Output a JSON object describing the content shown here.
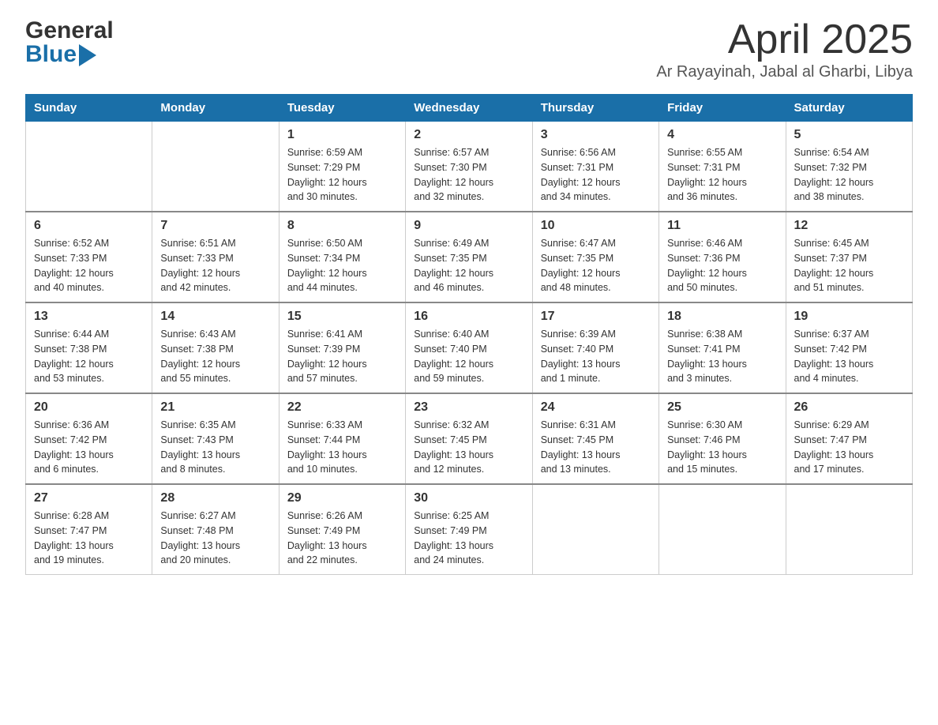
{
  "header": {
    "logo_general": "General",
    "logo_blue": "Blue",
    "title": "April 2025",
    "subtitle": "Ar Rayayinah, Jabal al Gharbi, Libya"
  },
  "calendar": {
    "days_of_week": [
      "Sunday",
      "Monday",
      "Tuesday",
      "Wednesday",
      "Thursday",
      "Friday",
      "Saturday"
    ],
    "weeks": [
      [
        {
          "day": "",
          "info": ""
        },
        {
          "day": "",
          "info": ""
        },
        {
          "day": "1",
          "info": "Sunrise: 6:59 AM\nSunset: 7:29 PM\nDaylight: 12 hours\nand 30 minutes."
        },
        {
          "day": "2",
          "info": "Sunrise: 6:57 AM\nSunset: 7:30 PM\nDaylight: 12 hours\nand 32 minutes."
        },
        {
          "day": "3",
          "info": "Sunrise: 6:56 AM\nSunset: 7:31 PM\nDaylight: 12 hours\nand 34 minutes."
        },
        {
          "day": "4",
          "info": "Sunrise: 6:55 AM\nSunset: 7:31 PM\nDaylight: 12 hours\nand 36 minutes."
        },
        {
          "day": "5",
          "info": "Sunrise: 6:54 AM\nSunset: 7:32 PM\nDaylight: 12 hours\nand 38 minutes."
        }
      ],
      [
        {
          "day": "6",
          "info": "Sunrise: 6:52 AM\nSunset: 7:33 PM\nDaylight: 12 hours\nand 40 minutes."
        },
        {
          "day": "7",
          "info": "Sunrise: 6:51 AM\nSunset: 7:33 PM\nDaylight: 12 hours\nand 42 minutes."
        },
        {
          "day": "8",
          "info": "Sunrise: 6:50 AM\nSunset: 7:34 PM\nDaylight: 12 hours\nand 44 minutes."
        },
        {
          "day": "9",
          "info": "Sunrise: 6:49 AM\nSunset: 7:35 PM\nDaylight: 12 hours\nand 46 minutes."
        },
        {
          "day": "10",
          "info": "Sunrise: 6:47 AM\nSunset: 7:35 PM\nDaylight: 12 hours\nand 48 minutes."
        },
        {
          "day": "11",
          "info": "Sunrise: 6:46 AM\nSunset: 7:36 PM\nDaylight: 12 hours\nand 50 minutes."
        },
        {
          "day": "12",
          "info": "Sunrise: 6:45 AM\nSunset: 7:37 PM\nDaylight: 12 hours\nand 51 minutes."
        }
      ],
      [
        {
          "day": "13",
          "info": "Sunrise: 6:44 AM\nSunset: 7:38 PM\nDaylight: 12 hours\nand 53 minutes."
        },
        {
          "day": "14",
          "info": "Sunrise: 6:43 AM\nSunset: 7:38 PM\nDaylight: 12 hours\nand 55 minutes."
        },
        {
          "day": "15",
          "info": "Sunrise: 6:41 AM\nSunset: 7:39 PM\nDaylight: 12 hours\nand 57 minutes."
        },
        {
          "day": "16",
          "info": "Sunrise: 6:40 AM\nSunset: 7:40 PM\nDaylight: 12 hours\nand 59 minutes."
        },
        {
          "day": "17",
          "info": "Sunrise: 6:39 AM\nSunset: 7:40 PM\nDaylight: 13 hours\nand 1 minute."
        },
        {
          "day": "18",
          "info": "Sunrise: 6:38 AM\nSunset: 7:41 PM\nDaylight: 13 hours\nand 3 minutes."
        },
        {
          "day": "19",
          "info": "Sunrise: 6:37 AM\nSunset: 7:42 PM\nDaylight: 13 hours\nand 4 minutes."
        }
      ],
      [
        {
          "day": "20",
          "info": "Sunrise: 6:36 AM\nSunset: 7:42 PM\nDaylight: 13 hours\nand 6 minutes."
        },
        {
          "day": "21",
          "info": "Sunrise: 6:35 AM\nSunset: 7:43 PM\nDaylight: 13 hours\nand 8 minutes."
        },
        {
          "day": "22",
          "info": "Sunrise: 6:33 AM\nSunset: 7:44 PM\nDaylight: 13 hours\nand 10 minutes."
        },
        {
          "day": "23",
          "info": "Sunrise: 6:32 AM\nSunset: 7:45 PM\nDaylight: 13 hours\nand 12 minutes."
        },
        {
          "day": "24",
          "info": "Sunrise: 6:31 AM\nSunset: 7:45 PM\nDaylight: 13 hours\nand 13 minutes."
        },
        {
          "day": "25",
          "info": "Sunrise: 6:30 AM\nSunset: 7:46 PM\nDaylight: 13 hours\nand 15 minutes."
        },
        {
          "day": "26",
          "info": "Sunrise: 6:29 AM\nSunset: 7:47 PM\nDaylight: 13 hours\nand 17 minutes."
        }
      ],
      [
        {
          "day": "27",
          "info": "Sunrise: 6:28 AM\nSunset: 7:47 PM\nDaylight: 13 hours\nand 19 minutes."
        },
        {
          "day": "28",
          "info": "Sunrise: 6:27 AM\nSunset: 7:48 PM\nDaylight: 13 hours\nand 20 minutes."
        },
        {
          "day": "29",
          "info": "Sunrise: 6:26 AM\nSunset: 7:49 PM\nDaylight: 13 hours\nand 22 minutes."
        },
        {
          "day": "30",
          "info": "Sunrise: 6:25 AM\nSunset: 7:49 PM\nDaylight: 13 hours\nand 24 minutes."
        },
        {
          "day": "",
          "info": ""
        },
        {
          "day": "",
          "info": ""
        },
        {
          "day": "",
          "info": ""
        }
      ]
    ]
  }
}
